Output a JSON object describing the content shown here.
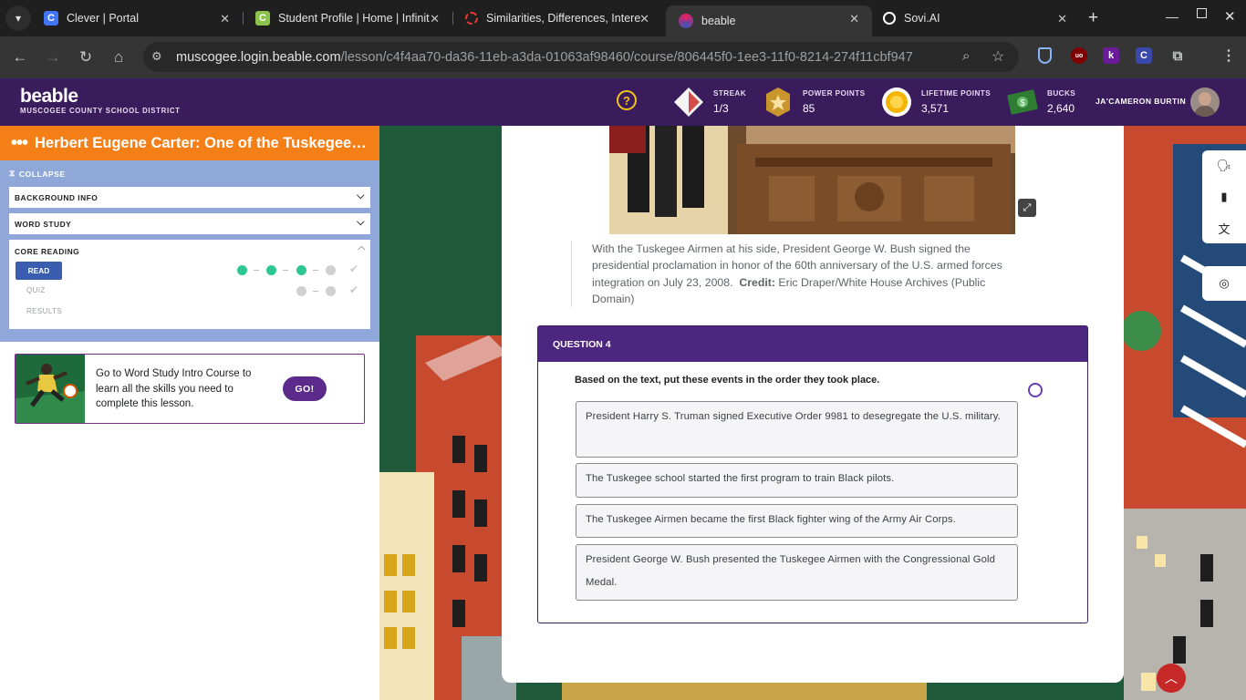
{
  "browser": {
    "tabs": [
      {
        "title": "Clever | Portal",
        "favicon": "C"
      },
      {
        "title": "Student Profile | Home | Infinit",
        "favicon": "C"
      },
      {
        "title": "Similarities, Differences, Intere",
        "favicon": ""
      },
      {
        "title": "beable",
        "favicon": ""
      },
      {
        "title": "Sovi.AI",
        "favicon": ""
      }
    ],
    "url_host": "muscogee.login.beable.com",
    "url_path": "/lesson/c4f4aa70-da36-11eb-a3da-01063af98460/course/806445f0-1ee3-11f0-8214-274f11cbf947"
  },
  "header": {
    "logo": "beable",
    "district": "MUSCOGEE COUNTY SCHOOL DISTRICT",
    "stats": [
      {
        "label": "STREAK",
        "value": "1/3"
      },
      {
        "label": "POWER POINTS",
        "value": "85"
      },
      {
        "label": "LIFETIME POINTS",
        "value": "3,571"
      },
      {
        "label": "BUCKS",
        "value": "2,640"
      }
    ],
    "username": "JA'CAMERON BURTIN"
  },
  "sidebar": {
    "lesson_title": "Herbert Eugene Carter: One of the Tuskegee Airmen",
    "collapse": "COLLAPSE",
    "sections": [
      "BACKGROUND INFO",
      "WORD STUDY"
    ],
    "core_reading": {
      "title": "CORE READING",
      "read": "READ",
      "quiz": "QUIZ",
      "results": "RESULTS"
    },
    "promo": {
      "text": "Go to Word Study Intro Course to learn all the skills you need to complete this lesson.",
      "button": "GO!"
    }
  },
  "content": {
    "caption_text": "With the Tuskegee Airmen at his side, President George W. Bush signed the presidential proclamation in honor of the 60th anniversary of the U.S. armed forces integration on July 23, 2008.",
    "caption_credit_label": "Credit:",
    "caption_credit": "Eric Draper/White House Archives (Public Domain)",
    "question": {
      "label": "QUESTION 4",
      "prompt": "Based on the text, put these events in the order they took place.",
      "options": [
        "President Harry S. Truman signed Executive Order 9981 to desegregate the U.S. military.",
        "The Tuskegee school started the first program to train Black pilots.",
        "The Tuskegee Airmen became the first Black fighter wing of the Army Air Corps.",
        "President George W. Bush presented the Tuskegee Airmen with the Congressional Gold Medal."
      ]
    }
  },
  "colors": {
    "header": "#3a1b5c",
    "lesson_bar": "#f57f17",
    "panel": "#8fa8d9",
    "question_header": "#4d2680",
    "progress_done": "#2ec794"
  },
  "icons": [
    "help-icon",
    "streak-icon",
    "power-points-icon",
    "lifetime-points-icon",
    "bucks-icon",
    "expand-icon",
    "read-aloud-icon",
    "glossary-icon",
    "translate-icon",
    "tools-icon",
    "scroll-top-icon"
  ]
}
